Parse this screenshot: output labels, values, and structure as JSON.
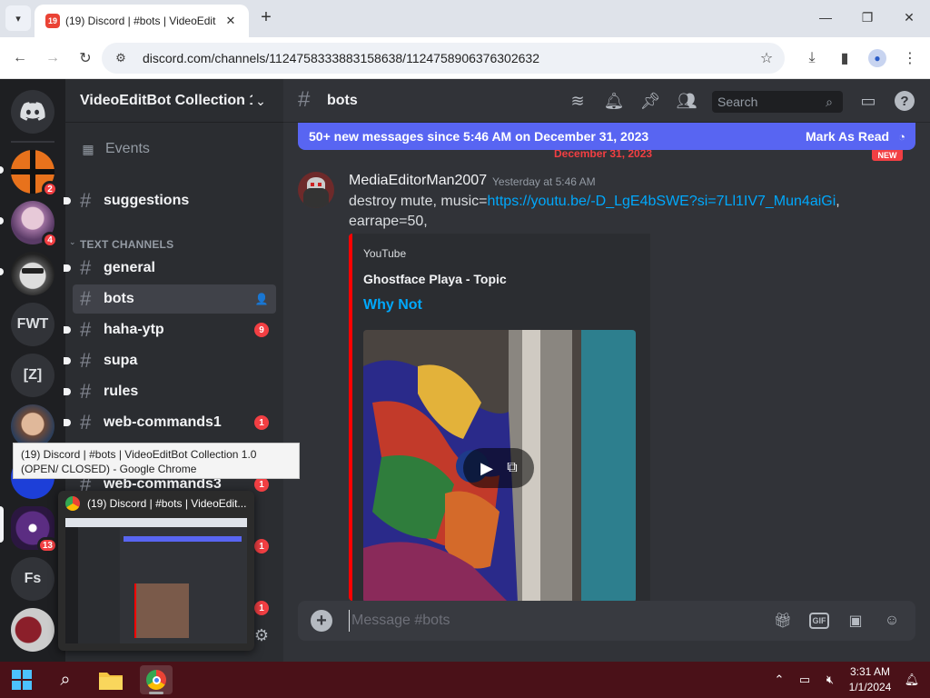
{
  "browser": {
    "tab_title": "(19) Discord | #bots | VideoEdit",
    "tab_badge": "19",
    "url": "discord.com/channels/1124758333883158638/1124758906376302632"
  },
  "servers": [
    {
      "label": "",
      "badge": ""
    },
    {
      "label": "",
      "badge": "2"
    },
    {
      "label": "",
      "badge": "4"
    },
    {
      "label": "",
      "badge": ""
    },
    {
      "label": "FWT",
      "badge": ""
    },
    {
      "label": "[Z]",
      "badge": ""
    },
    {
      "label": "",
      "badge": ""
    },
    {
      "label": "",
      "badge": "13"
    },
    {
      "label": "Fs",
      "badge": ""
    },
    {
      "label": "",
      "badge": ""
    }
  ],
  "sidebar": {
    "guild_name": "VideoEditBot Collection 1.0",
    "events_label": "Events",
    "category": "TEXT CHANNELS",
    "channels": [
      {
        "name": "suggestions",
        "badge": ""
      },
      {
        "name": "general",
        "badge": ""
      },
      {
        "name": "bots",
        "badge": ""
      },
      {
        "name": "haha-ytp",
        "badge": "9"
      },
      {
        "name": "supa",
        "badge": ""
      },
      {
        "name": "rules",
        "badge": ""
      },
      {
        "name": "web-commands1",
        "badge": "1"
      },
      {
        "name": "web-commands3",
        "badge": "1"
      },
      {
        "name": "",
        "badge": "1"
      },
      {
        "name": "",
        "badge": "1"
      }
    ]
  },
  "chat": {
    "channel_name": "bots",
    "search_placeholder": "Search",
    "new_messages_text": "50+ new messages since 5:46 AM on December 31, 2023",
    "mark_read_label": "Mark As Read",
    "date_divider": "December 31, 2023",
    "new_label": "NEW",
    "message": {
      "author": "MediaEditorMan2007",
      "timestamp": "Yesterday at 5:46 AM",
      "text_prefix": "destroy mute, music=",
      "link": "https://youtu.be/-D_LgE4bSWE?si=7Ll1IV7_Mun4aiGi",
      "text_suffix": ",",
      "text_line2": "earrape=50,"
    },
    "embed": {
      "provider": "YouTube",
      "author": "Ghostface Playa - Topic",
      "title": "Why Not",
      "accent": "#ff0000"
    },
    "composer_placeholder": "Message #bots"
  },
  "tooltip": "(19) Discord | #bots | VideoEditBot Collection 1.0 (OPEN/ CLOSED) - Google Chrome",
  "preview_title": "(19) Discord | #bots | VideoEdit...",
  "taskbar": {
    "time": "3:31 AM",
    "date": "1/1/2024"
  },
  "colors": {
    "blurple": "#5865f2",
    "link": "#00a8fc",
    "badge_red": "#f23f43"
  }
}
